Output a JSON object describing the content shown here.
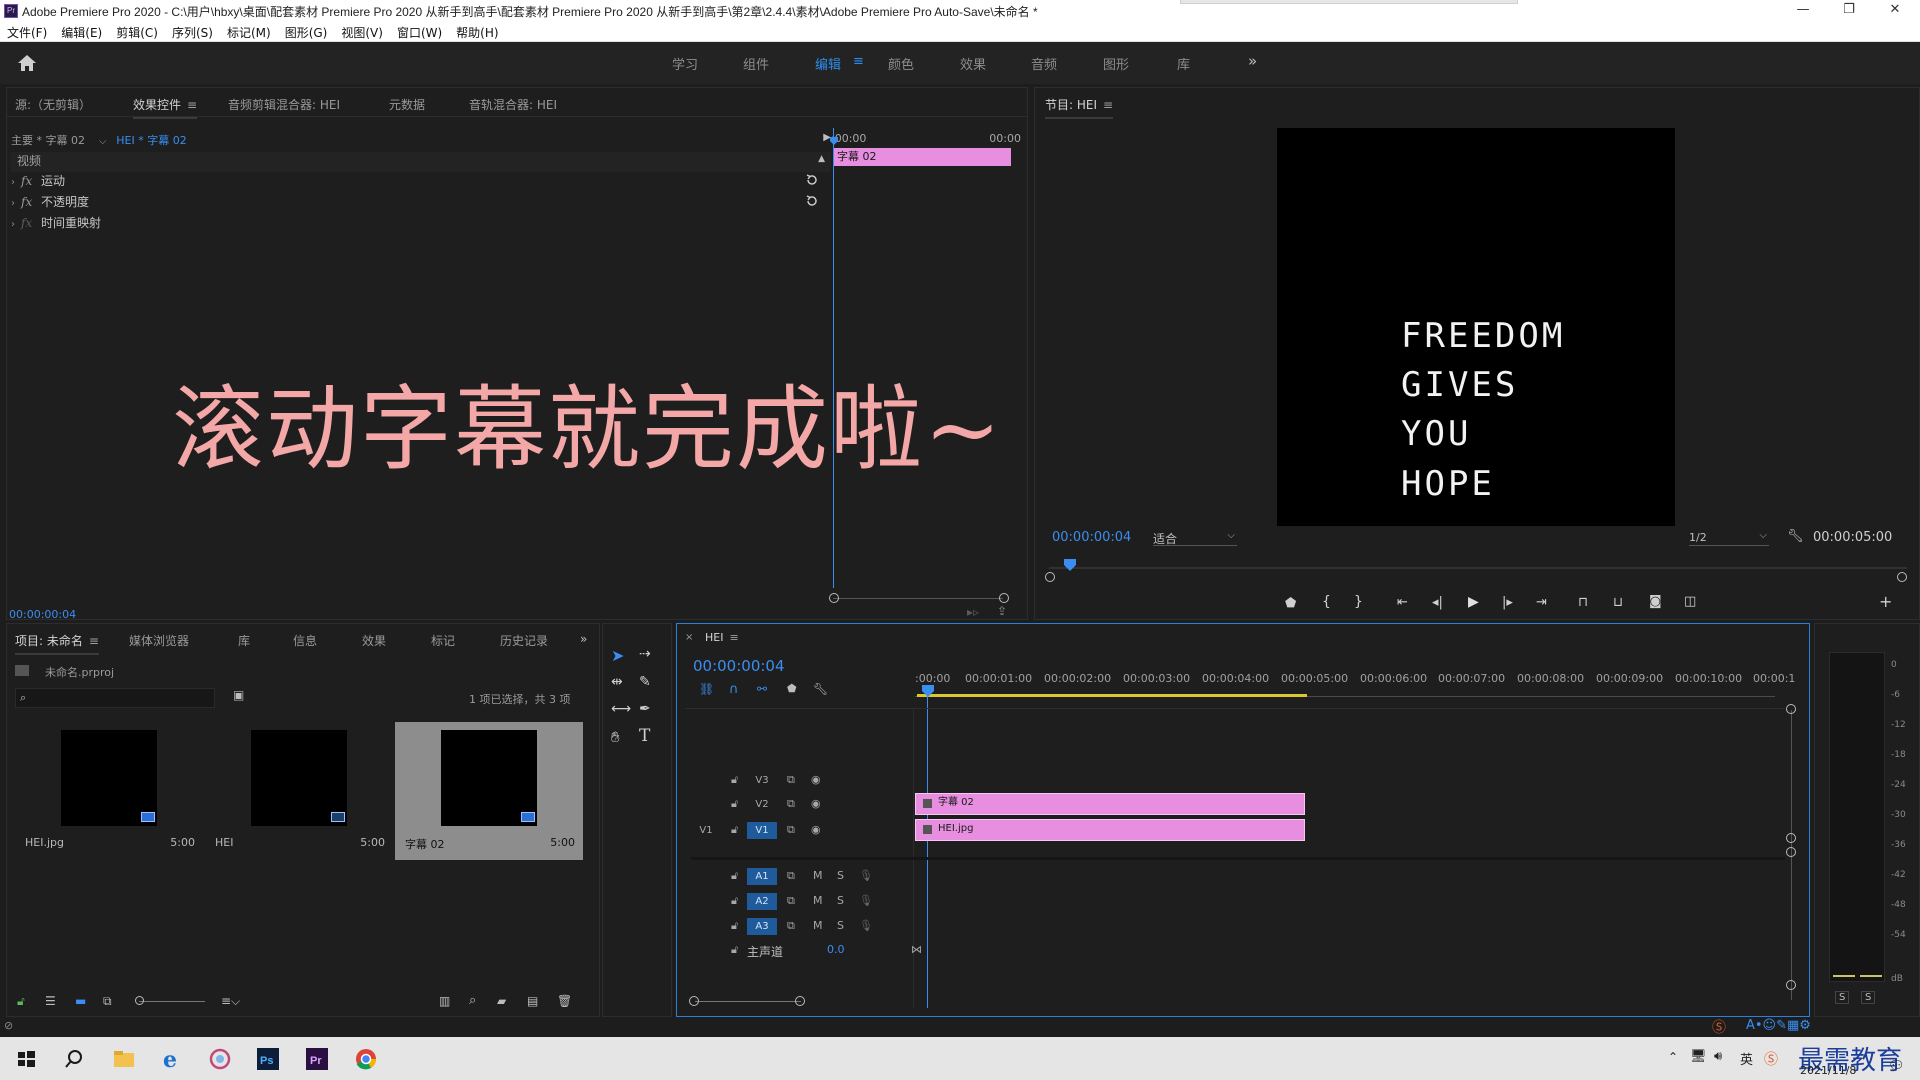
{
  "window": {
    "title": "Adobe Premiere Pro 2020 - C:\\用户\\hbxy\\桌面\\配套素材 Premiere Pro 2020 从新手到高手\\配套素材 Premiere Pro 2020 从新手到高手\\第2章\\2.4.4\\素材\\Adobe Premiere Pro Auto-Save\\未命名 *",
    "app_badge": "Pr",
    "minimize": "—",
    "restore": "❐",
    "close": "✕"
  },
  "menu": [
    "文件(F)",
    "编辑(E)",
    "剪辑(C)",
    "序列(S)",
    "标记(M)",
    "图形(G)",
    "视图(V)",
    "窗口(W)",
    "帮助(H)"
  ],
  "workspace": {
    "tabs": [
      "学习",
      "组件",
      "编辑",
      "颜色",
      "效果",
      "音频",
      "图形",
      "库"
    ],
    "active": "编辑",
    "menu_glyph": "≡",
    "more": "»"
  },
  "effect_controls": {
    "tabs": [
      "源:（无剪辑）",
      "效果控件",
      "音频剪辑混合器: HEI",
      "元数据",
      "音轨混合器: HEI"
    ],
    "active_tab": "效果控件",
    "master_clip": "主要 * 字幕 02",
    "sequence_clip": "HEI * 字幕 02",
    "section": "视频",
    "effects": [
      {
        "name": "运动",
        "fx": "fx"
      },
      {
        "name": "不透明度",
        "fx": "fx"
      },
      {
        "name": "时间重映射",
        "fx": "fx"
      }
    ],
    "ruler_start": ":00:00",
    "ruler_end": "00:00",
    "clip_label": "字幕 02",
    "timecode": "00:00:00:04"
  },
  "overlay_caption": "滚动字幕就完成啦~",
  "program": {
    "title": "节目: HEI",
    "lines": [
      "FREEDOM",
      "GIVES",
      "YOU",
      "HOPE"
    ],
    "timecode": "00:00:00:04",
    "fit": "适合",
    "resolution": "1/2",
    "duration": "00:00:05:00"
  },
  "project": {
    "tabs": [
      "项目: 未命名",
      "媒体浏览器",
      "库",
      "信息",
      "效果",
      "标记",
      "历史记录"
    ],
    "active_tab": "项目: 未命名",
    "file": "未命名.prproj",
    "selection_info": "1 项已选择，共 3 项",
    "items": [
      {
        "name": "HEI.jpg",
        "duration": "5:00"
      },
      {
        "name": "HEI",
        "duration": "5:00"
      },
      {
        "name": "字幕 02",
        "duration": "5:00"
      }
    ]
  },
  "timeline": {
    "sequence": "HEI",
    "timecode": "00:00:00:04",
    "ruler": [
      ":00:00",
      "00:00:01:00",
      "00:00:02:00",
      "00:00:03:00",
      "00:00:04:00",
      "00:00:05:00",
      "00:00:06:00",
      "00:00:07:00",
      "00:00:08:00",
      "00:00:09:00",
      "00:00:10:00",
      "00:00:1"
    ],
    "tracks": {
      "video": [
        {
          "id": "V3",
          "src": ""
        },
        {
          "id": "V2",
          "src": ""
        },
        {
          "id": "V1",
          "src": "V1"
        }
      ],
      "audio": [
        {
          "id": "A1",
          "m": "M",
          "s": "S"
        },
        {
          "id": "A2",
          "m": "M",
          "s": "S"
        },
        {
          "id": "A3",
          "m": "M",
          "s": "S"
        }
      ]
    },
    "master_label": "主声道",
    "master_value": "0.0",
    "clips": {
      "v2": "字幕 02",
      "v1": "HEI.jpg"
    }
  },
  "audio_meter": {
    "scale": [
      "0",
      "-6",
      "-12",
      "-18",
      "-24",
      "-30",
      "-36",
      "-42",
      "-48",
      "-54",
      "dB"
    ],
    "solo": [
      "S",
      "S"
    ]
  },
  "taskbar": {
    "watermark": "最需教育",
    "date": "2021/11/8",
    "ime": "英"
  },
  "colors": {
    "accent": "#2d8ceb",
    "clip_pink": "#e88ee0",
    "caption_pink": "#f3a7a7"
  }
}
